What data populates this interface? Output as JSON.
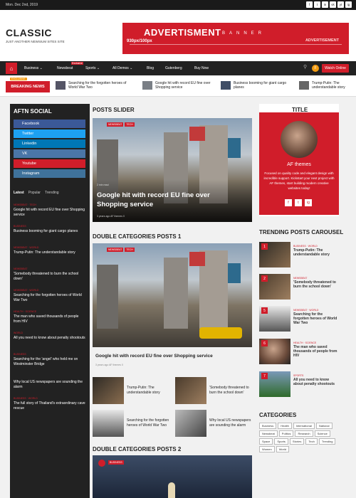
{
  "topbar": {
    "date": "Mon. Dec 2nd, 2019",
    "social_icons": [
      "f",
      "t",
      "in",
      "vk",
      "yt",
      "ig"
    ]
  },
  "header": {
    "logo": "CLASSIC",
    "tagline": "JUST ANOTHER NEWSIUM SITES SITE",
    "ad": {
      "title": "ADVERTISMENT",
      "banner": "BANNER",
      "size": "930px/100px",
      "sub": "ADVERTISEMENT"
    }
  },
  "nav": {
    "items": [
      "Business ⌄",
      "Newsbeat",
      "Sports ⌄",
      "All Demos ⌄",
      "Blog",
      "Gutenberg",
      "Buy Now"
    ],
    "hot_badge": "Exclusive",
    "watch": "Watch Online",
    "circle_label": "F"
  },
  "ticker": {
    "badge": "BREAKING NEWS",
    "exclusive": "EXCLUSIVE",
    "items": [
      "Searching for the forgotten heroes of World War Two",
      "Google hit with record EU fine over Shopping service",
      "Business booming for giant cargo planes",
      "Trump-Putin: The understandable story"
    ]
  },
  "left": {
    "title": "AFTN SOCIAL",
    "socials": [
      {
        "label": "Facebook",
        "color": "#3b5998"
      },
      {
        "label": "Twitter",
        "color": "#1da1f2"
      },
      {
        "label": "Linkedin",
        "color": "#0077b5"
      },
      {
        "label": "VK",
        "color": "#4a76a8"
      },
      {
        "label": "Youtube",
        "color": "#d01d2a"
      },
      {
        "label": "Instagram",
        "color": "#3f729b"
      }
    ],
    "tabs": [
      "Latest",
      "Popular",
      "Trending"
    ],
    "posts": [
      {
        "cat": "NEWSBEAT · TECH",
        "title": "Google hit with record EU fine over Shopping service"
      },
      {
        "cat": "BUSINESS",
        "title": "Business booming for giant cargo planes"
      },
      {
        "cat": "NEWSBEAT · WORLD",
        "title": "Trump-Putin: The understandable story"
      },
      {
        "cat": "NEWSBEAT",
        "title": "'Somebody threatened to burn the school down'"
      },
      {
        "cat": "NEWSBEAT · WORLD",
        "title": "Searching for the forgotten heroes of World War Two"
      },
      {
        "cat": "HEALTH · SCIENCE",
        "title": "The man who saved thousands of people from HIV"
      },
      {
        "cat": "WORLD",
        "title": "All you need to know about penalty shootouts"
      },
      {
        "cat": "BUSINESS",
        "title": "Searching for the 'angel' who held me on Westminster Bridge"
      },
      {
        "cat": "",
        "title": "Why local US newspapers are sounding the alarm"
      },
      {
        "cat": "BUSINESS · WORLD",
        "title": "The full story of Thailand's extraordinary cave rescue"
      }
    ]
  },
  "center": {
    "slider_title": "POSTS SLIDER",
    "slider_tags": [
      "NEWSBEAT",
      "TECH"
    ],
    "slider_read": "2 min read",
    "slider_post": "Google hit with record EU fine over Shopping service",
    "slider_meta": "3 years ago   AF themes   0",
    "dc1_title": "DOUBLE CATEGORIES POSTS 1",
    "dc1_tags": [
      "NEWSBEAT",
      "TECH"
    ],
    "dc1_post": "Google hit with record EU fine over Shopping service",
    "dc1_meta": "3 years ago   AF themes   0",
    "small_posts": [
      "Trump-Putin: The understandable story",
      "'Somebody threatened to burn the school down'",
      "Searching for the forgotten heroes of World War Two",
      "Why local US newspapers are sounding the alarm"
    ],
    "dc2_title": "DOUBLE CATEGORIES POSTS 2",
    "dc2_tags": [
      "BUSINESS"
    ]
  },
  "right": {
    "title": "TITLE",
    "author": "AF themes",
    "bio": "Focused on quality code and elegant design with incredible support. Kickstart your next project with AF themes, start building modern creative websites today!",
    "socials": [
      "f",
      "t",
      "ig"
    ],
    "trending_title": "TRENDING POSTS CAROUSEL",
    "trending": [
      {
        "num": "1",
        "cat": "BUSINESS · WORLD",
        "title": "Trump-Putin: The understandable story"
      },
      {
        "num": "2",
        "cat": "NEWSBEAT",
        "title": "'Somebody threatened to burn the school down'"
      },
      {
        "num": "5",
        "cat": "NEWSBEAT · WORLD",
        "title": "Searching for the forgotten heroes of World War Two"
      },
      {
        "num": "6",
        "cat": "HEALTH · SCIENCE",
        "title": "The man who saved thousands of people from HIV"
      },
      {
        "num": "7",
        "cat": "SPORTS",
        "title": "All you need to know about penalty shootouts"
      }
    ],
    "categories_title": "CATEGORIES",
    "categories": [
      "Business",
      "Health",
      "International",
      "National",
      "Newsbeat",
      "Politics",
      "Research",
      "Science",
      "Space",
      "Sports",
      "Stories",
      "Tech",
      "Trending",
      "Women",
      "World"
    ]
  }
}
